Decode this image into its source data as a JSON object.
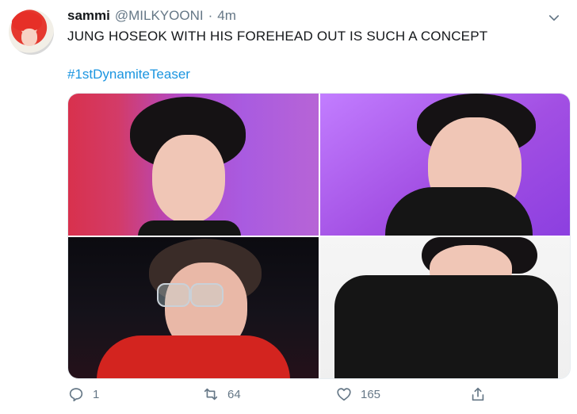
{
  "tweet": {
    "name": "sammi",
    "handle": "@MILKYOONI",
    "separator": "·",
    "time": "4m",
    "text": "JUNG HOSEOK WITH HIS FOREHEAD OUT IS SUCH A CONCEPT",
    "hashtag": "#1stDynamiteTeaser"
  },
  "actions": {
    "reply_count": "1",
    "retweet_count": "64",
    "like_count": "165"
  },
  "colors": {
    "link": "#1b95e0",
    "secondary_text": "#657786"
  },
  "icons": {
    "more": "chevron-down-icon",
    "reply": "reply-icon",
    "retweet": "retweet-icon",
    "like": "heart-icon",
    "share": "share-icon"
  }
}
